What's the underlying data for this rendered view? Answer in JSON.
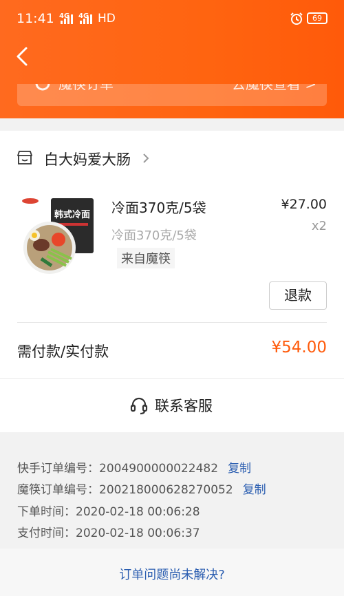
{
  "status_bar": {
    "time": "11:41",
    "signal1": "4G",
    "signal2": "4G",
    "hd": "HD",
    "battery": "69"
  },
  "header": {
    "mofang_order_label": "魔筷订单",
    "mofang_link": "去魔筷查看 >",
    "brand_color": "#ff6410"
  },
  "store": {
    "name": "白大妈爱大肠"
  },
  "item": {
    "name": "冷面370克/5袋",
    "sku": "冷面370克/5袋",
    "source": "来自魔筷",
    "price": "¥27.00",
    "quantity": "x2",
    "package_title": "韩式冷面",
    "refund_label": "退款"
  },
  "payment": {
    "label": "需付款/实付款",
    "amount": "¥54.00",
    "amount_color": "#ff5a0a"
  },
  "customer_service": {
    "label": "联系客服"
  },
  "order_info": {
    "kuaishou_label": "快手订单编号：",
    "kuaishou_no": "2004900000022482",
    "mofang_label": "魔筷订单编号：",
    "mofang_no": "200218000628270052",
    "copy_label": "复制",
    "order_time_label": "下单时间：",
    "order_time": "2020-02-18 00:06:28",
    "pay_time_label": "支付时间：",
    "pay_time": "2020-02-18 00:06:37"
  },
  "footer": {
    "link": "订单问题尚未解决?"
  }
}
